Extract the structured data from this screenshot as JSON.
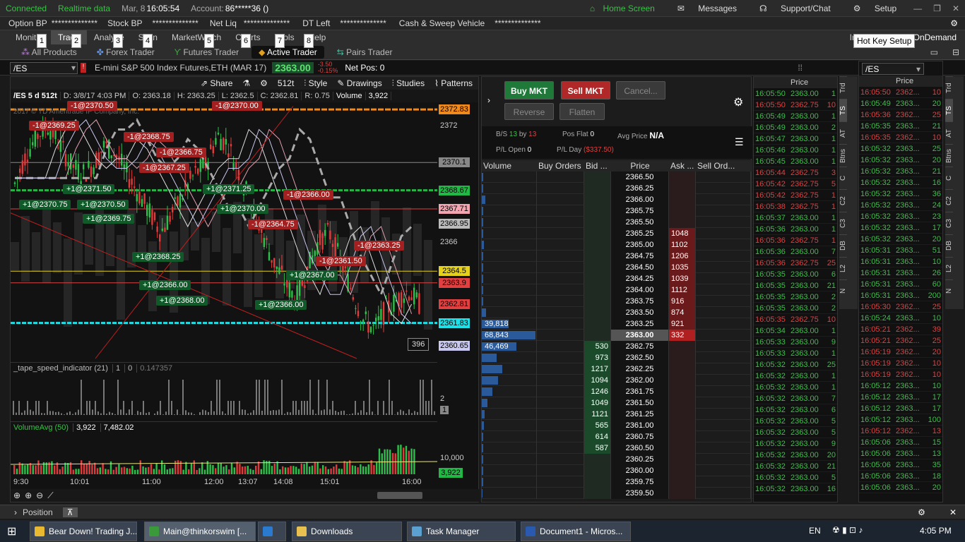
{
  "topbar": {
    "connected": "Connected",
    "realtime": "Realtime data",
    "date": "Mar, 8",
    "time": "16:05:54",
    "account_label": "Account:",
    "account_value": "86*****36 ()",
    "home": "Home Screen",
    "messages": "Messages",
    "support": "Support/Chat",
    "setup": "Setup"
  },
  "bpbar": {
    "option_bp": "Option BP",
    "option_val": "**************",
    "stock_bp": "Stock BP",
    "stock_val": "**************",
    "net_liq": "Net Liq",
    "net_val": "**************",
    "dt_left": "DT Left",
    "dt_val": "**************",
    "cash": "Cash & Sweep Vehicle",
    "cash_val": "**************"
  },
  "tabs": [
    "Monitor",
    "Trade",
    "Analyze",
    "Scan",
    "MarketWatch",
    "Charts",
    "Tools",
    "Help"
  ],
  "hotkeys": [
    "1",
    "2",
    "3",
    "4",
    "5",
    "6",
    "7",
    "8"
  ],
  "tabs_right": {
    "in": "In",
    "ondemand": "OnDemand"
  },
  "tooltip": "Hot Key Setup",
  "subtabs": [
    "All Products",
    "Forex Trader",
    "Futures Trader",
    "Active Trader",
    "Pairs Trader"
  ],
  "symbar": {
    "symbol": "/ES",
    "description": "E-mini S&P 500 Index Futures,ETH (MAR 17)",
    "last": "2363.00",
    "change": "-3.50",
    "change_pct": "-0.15%",
    "netpos": "Net Pos: 0"
  },
  "chart": {
    "toolbar": [
      "Share",
      "512t",
      "Style",
      "Drawings",
      "Studies",
      "Patterns"
    ],
    "info": {
      "symbol": "/ES 5 d 512t",
      "date": "D: 3/8/17 4:03 PM",
      "open": "O: 2363.18",
      "high": "H: 2363.25",
      "low": "L: 2362.5",
      "close": "C: 2362.81",
      "range": "R: 0.75",
      "vol_label": "Volume",
      "vol": "3,922"
    },
    "watermark": "2017 © TD Ameritrade IP Company, Inc.",
    "axis_tags": [
      {
        "v": "2372.83",
        "c": "#f08a1c"
      },
      {
        "v": "2370.1",
        "c": "#888888"
      },
      {
        "v": "2368.67",
        "c": "#22b845"
      },
      {
        "v": "2367.71",
        "c": "#f2a4b0"
      },
      {
        "v": "2366.95",
        "c": "#bbbbbb"
      },
      {
        "v": "2364.5",
        "c": "#e6d11a"
      },
      {
        "v": "2363.9",
        "c": "#e04040"
      },
      {
        "v": "2362.81",
        "c": "#e04040"
      },
      {
        "v": "2361.83",
        "c": "#1ee0e8"
      },
      {
        "v": "2360.65",
        "c": "#c8c8f0"
      }
    ],
    "axis_labels": [
      "2372",
      "2366"
    ],
    "orders": [
      {
        "t": "-1@2370.50",
        "k": "s"
      },
      {
        "t": "-1@2370.00",
        "k": "s"
      },
      {
        "t": "-1@2369.25",
        "k": "s"
      },
      {
        "t": "-1@2368.75",
        "k": "s"
      },
      {
        "t": "-1@2366.75",
        "k": "s"
      },
      {
        "t": "-1@2367.25",
        "k": "s"
      },
      {
        "t": "+1@2371.50",
        "k": "b"
      },
      {
        "t": "+1@2371.25",
        "k": "b"
      },
      {
        "t": "+1@2370.75",
        "k": "b"
      },
      {
        "t": "+1@2370.50",
        "k": "b"
      },
      {
        "t": "+1@2370.00",
        "k": "b"
      },
      {
        "t": "+1@2369.75",
        "k": "b"
      },
      {
        "t": "-1@2366.00",
        "k": "s"
      },
      {
        "t": "-1@2364.75",
        "k": "s"
      },
      {
        "t": "-1@2363.25",
        "k": "s"
      },
      {
        "t": "-1@2361.50",
        "k": "s"
      },
      {
        "t": "+1@2368.25",
        "k": "b"
      },
      {
        "t": "+1@2367.00",
        "k": "b"
      },
      {
        "t": "+1@2366.00",
        "k": "b"
      },
      {
        "t": "+1@2368.00",
        "k": "b"
      },
      {
        "t": "+1@2366.00",
        "k": "b"
      }
    ],
    "tick_counter": "396",
    "tape_title": "_tape_speed_indicator (21)",
    "tape_vals": [
      "1",
      "0",
      "0.147357"
    ],
    "tape_axis": [
      "2",
      "1"
    ],
    "vol_title": "VolumeAvg (50)",
    "vol_vals": [
      "3,922",
      "7,482.02"
    ],
    "vol_axis": "10,000",
    "vol_tag": "3,922",
    "time_labels": [
      "9:30",
      "10:01",
      "11:00",
      "12:00",
      "13:07",
      "14:08",
      "15:01",
      "16:00"
    ]
  },
  "trader": {
    "buy": "Buy MKT",
    "sell": "Sell MKT",
    "cancel": "Cancel...",
    "reverse": "Reverse",
    "flatten": "Flatten",
    "bs_label": "B/S",
    "bs_val": "13",
    "by": "by",
    "bs_val2": "13",
    "pos_flat": "Pos Flat",
    "pos_val": "0",
    "avg_price": "Avg Price",
    "avg_val": "N/A",
    "pl_open": "P/L Open",
    "pl_open_val": "0",
    "pl_day": "P/L Day",
    "pl_day_val": "($337.50)",
    "headers": [
      "Volume",
      "Buy Orders",
      "Bid ...",
      "Price",
      "Ask ...",
      "Sell Ord..."
    ],
    "rows": [
      {
        "p": "2366.50",
        "bid": "",
        "ask": "",
        "v": "",
        "vw": 0.02
      },
      {
        "p": "2366.25",
        "bid": "",
        "ask": "",
        "v": "",
        "vw": 0.03
      },
      {
        "p": "2366.00",
        "bid": "",
        "ask": "",
        "v": "",
        "vw": 0.06
      },
      {
        "p": "2365.75",
        "bid": "",
        "ask": "",
        "v": "",
        "vw": 0.03
      },
      {
        "p": "2365.50",
        "bid": "",
        "ask": "",
        "v": "",
        "vw": 0.02
      },
      {
        "p": "2365.25",
        "bid": "",
        "ask": "1048",
        "v": "",
        "vw": 0.02
      },
      {
        "p": "2365.00",
        "bid": "",
        "ask": "1102",
        "v": "",
        "vw": 0.04
      },
      {
        "p": "2364.75",
        "bid": "",
        "ask": "1206",
        "v": "",
        "vw": 0.02
      },
      {
        "p": "2364.50",
        "bid": "",
        "ask": "1035",
        "v": "",
        "vw": 0.03
      },
      {
        "p": "2364.25",
        "bid": "",
        "ask": "1039",
        "v": "",
        "vw": 0.02
      },
      {
        "p": "2364.00",
        "bid": "",
        "ask": "1112",
        "v": "",
        "vw": 0.02
      },
      {
        "p": "2363.75",
        "bid": "",
        "ask": "916",
        "v": "",
        "vw": 0.03
      },
      {
        "p": "2363.50",
        "bid": "",
        "ask": "874",
        "v": "",
        "vw": 0.08
      },
      {
        "p": "2363.25",
        "bid": "",
        "ask": "921",
        "v": "39,818",
        "vw": 0.5
      },
      {
        "p": "2363.00",
        "bid": "",
        "ask": "332",
        "v": "68,843",
        "vw": 1.0,
        "cur": true
      },
      {
        "p": "2362.75",
        "bid": "530",
        "ask": "",
        "v": "46,469",
        "vw": 0.65
      },
      {
        "p": "2362.50",
        "bid": "973",
        "ask": "",
        "v": "",
        "vw": 0.28
      },
      {
        "p": "2362.25",
        "bid": "1217",
        "ask": "",
        "v": "",
        "vw": 0.38
      },
      {
        "p": "2362.00",
        "bid": "1094",
        "ask": "",
        "v": "",
        "vw": 0.3
      },
      {
        "p": "2361.75",
        "bid": "1246",
        "ask": "",
        "v": "",
        "vw": 0.2
      },
      {
        "p": "2361.50",
        "bid": "1049",
        "ask": "",
        "v": "",
        "vw": 0.1
      },
      {
        "p": "2361.25",
        "bid": "1121",
        "ask": "",
        "v": "",
        "vw": 0.05
      },
      {
        "p": "2361.00",
        "bid": "565",
        "ask": "",
        "v": "",
        "vw": 0.04
      },
      {
        "p": "2360.75",
        "bid": "614",
        "ask": "",
        "v": "",
        "vw": 0.03
      },
      {
        "p": "2360.50",
        "bid": "587",
        "ask": "",
        "v": "",
        "vw": 0.02
      },
      {
        "p": "2360.25",
        "bid": "",
        "ask": "",
        "v": "",
        "vw": 0.02
      },
      {
        "p": "2360.00",
        "bid": "",
        "ask": "",
        "v": "",
        "vw": 0.02
      },
      {
        "p": "2359.75",
        "bid": "",
        "ask": "",
        "v": "",
        "vw": 0.02
      },
      {
        "p": "2359.50",
        "bid": "",
        "ask": "",
        "v": "",
        "vw": 0.01
      }
    ]
  },
  "ts1": {
    "header": "Price",
    "side_tabs": [
      "Trd",
      "TS",
      "AT",
      "Btns",
      "C",
      "C2",
      "C3",
      "DB",
      "L2",
      "N"
    ],
    "rows": [
      [
        "16:05:50",
        "2363.00",
        "1",
        "g"
      ],
      [
        "16:05:50",
        "2362.75",
        "10",
        "r"
      ],
      [
        "16:05:49",
        "2363.00",
        "1",
        "g"
      ],
      [
        "16:05:49",
        "2363.00",
        "2",
        "g"
      ],
      [
        "16:05:47",
        "2363.00",
        "1",
        "g"
      ],
      [
        "16:05:46",
        "2363.00",
        "1",
        "g"
      ],
      [
        "16:05:45",
        "2363.00",
        "1",
        "g"
      ],
      [
        "16:05:44",
        "2362.75",
        "3",
        "r"
      ],
      [
        "16:05:42",
        "2362.75",
        "5",
        "r"
      ],
      [
        "16:05:42",
        "2362.75",
        "1",
        "r"
      ],
      [
        "16:05:38",
        "2362.75",
        "1",
        "r"
      ],
      [
        "16:05:37",
        "2363.00",
        "1",
        "g"
      ],
      [
        "16:05:36",
        "2363.00",
        "1",
        "g"
      ],
      [
        "16:05:36",
        "2362.75",
        "1",
        "r"
      ],
      [
        "16:05:36",
        "2363.00",
        "7",
        "g"
      ],
      [
        "16:05:36",
        "2362.75",
        "25",
        "r"
      ],
      [
        "16:05:35",
        "2363.00",
        "6",
        "g"
      ],
      [
        "16:05:35",
        "2363.00",
        "21",
        "g"
      ],
      [
        "16:05:35",
        "2363.00",
        "2",
        "g"
      ],
      [
        "16:05:35",
        "2363.00",
        "2",
        "g"
      ],
      [
        "16:05:35",
        "2362.75",
        "10",
        "r"
      ],
      [
        "16:05:34",
        "2363.00",
        "1",
        "g"
      ],
      [
        "16:05:33",
        "2363.00",
        "9",
        "g"
      ],
      [
        "16:05:33",
        "2363.00",
        "1",
        "g"
      ],
      [
        "16:05:32",
        "2363.00",
        "25",
        "g"
      ],
      [
        "16:05:32",
        "2363.00",
        "1",
        "g"
      ],
      [
        "16:05:32",
        "2363.00",
        "1",
        "g"
      ],
      [
        "16:05:32",
        "2363.00",
        "7",
        "g"
      ],
      [
        "16:05:32",
        "2363.00",
        "6",
        "g"
      ],
      [
        "16:05:32",
        "2363.00",
        "5",
        "g"
      ],
      [
        "16:05:32",
        "2363.00",
        "5",
        "g"
      ],
      [
        "16:05:32",
        "2363.00",
        "9",
        "g"
      ],
      [
        "16:05:32",
        "2363.00",
        "20",
        "g"
      ],
      [
        "16:05:32",
        "2363.00",
        "21",
        "g"
      ],
      [
        "16:05:32",
        "2363.00",
        "5",
        "g"
      ],
      [
        "16:05:32",
        "2363.00",
        "16",
        "g"
      ]
    ]
  },
  "ts2": {
    "symbol": "/ES",
    "header": "Price",
    "side_tabs": [
      "Trd",
      "TS",
      "AT",
      "Btns",
      "C",
      "C2",
      "C3",
      "DB",
      "L2",
      "N"
    ],
    "rows": [
      [
        "16:05:50",
        "2362...",
        "10",
        "r"
      ],
      [
        "16:05:49",
        "2363...",
        "20",
        "g"
      ],
      [
        "16:05:36",
        "2362...",
        "25",
        "r"
      ],
      [
        "16:05:35",
        "2363...",
        "21",
        "g"
      ],
      [
        "16:05:35",
        "2362...",
        "10",
        "r"
      ],
      [
        "16:05:32",
        "2363...",
        "25",
        "g"
      ],
      [
        "16:05:32",
        "2363...",
        "20",
        "g"
      ],
      [
        "16:05:32",
        "2363...",
        "21",
        "g"
      ],
      [
        "16:05:32",
        "2363...",
        "16",
        "g"
      ],
      [
        "16:05:32",
        "2363...",
        "36",
        "g"
      ],
      [
        "16:05:32",
        "2363...",
        "24",
        "g"
      ],
      [
        "16:05:32",
        "2363...",
        "23",
        "g"
      ],
      [
        "16:05:32",
        "2363...",
        "17",
        "g"
      ],
      [
        "16:05:32",
        "2363...",
        "20",
        "g"
      ],
      [
        "16:05:31",
        "2363...",
        "51",
        "g"
      ],
      [
        "16:05:31",
        "2363...",
        "10",
        "g"
      ],
      [
        "16:05:31",
        "2363...",
        "26",
        "g"
      ],
      [
        "16:05:31",
        "2363...",
        "60",
        "g"
      ],
      [
        "16:05:31",
        "2363...",
        "200",
        "g"
      ],
      [
        "16:05:30",
        "2362...",
        "25",
        "r"
      ],
      [
        "16:05:24",
        "2363...",
        "10",
        "g"
      ],
      [
        "16:05:21",
        "2362...",
        "39",
        "r"
      ],
      [
        "16:05:21",
        "2362...",
        "25",
        "r"
      ],
      [
        "16:05:19",
        "2362...",
        "20",
        "r"
      ],
      [
        "16:05:19",
        "2362...",
        "10",
        "r"
      ],
      [
        "16:05:19",
        "2362...",
        "10",
        "r"
      ],
      [
        "16:05:12",
        "2363...",
        "10",
        "g"
      ],
      [
        "16:05:12",
        "2363...",
        "17",
        "g"
      ],
      [
        "16:05:12",
        "2363...",
        "17",
        "g"
      ],
      [
        "16:05:12",
        "2363...",
        "100",
        "g"
      ],
      [
        "16:05:12",
        "2362...",
        "13",
        "r"
      ],
      [
        "16:05:06",
        "2363...",
        "15",
        "g"
      ],
      [
        "16:05:06",
        "2363...",
        "13",
        "g"
      ],
      [
        "16:05:06",
        "2363...",
        "35",
        "g"
      ],
      [
        "16:05:06",
        "2363...",
        "18",
        "g"
      ],
      [
        "16:05:06",
        "2363...",
        "20",
        "g"
      ]
    ]
  },
  "position": {
    "label": "Position"
  },
  "taskbar": {
    "apps": [
      {
        "t": "Bear Down! Trading J...",
        "c": "#e8b830"
      },
      {
        "t": "Main@thinkorswim [...",
        "c": "#3a9a3a"
      },
      {
        "t": "",
        "c": "#2a7ad0"
      },
      {
        "t": "Downloads",
        "c": "#e8c050"
      },
      {
        "t": "Task Manager",
        "c": "#5aa0d0"
      },
      {
        "t": "Document1 - Micros...",
        "c": "#2a5ab0"
      }
    ],
    "lang": "EN",
    "clock": "4:05 PM"
  }
}
